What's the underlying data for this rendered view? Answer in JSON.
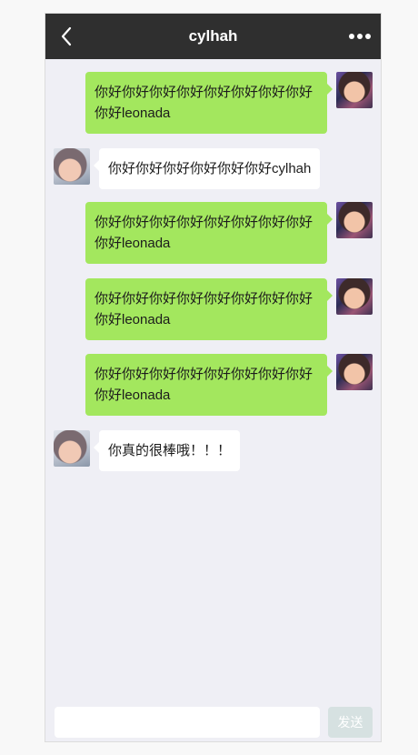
{
  "header": {
    "title": "cylhah",
    "back_icon": "chevron-left-icon",
    "more_icon": "more-dots-icon"
  },
  "messages": [
    {
      "from": "me",
      "text": "你好你好你好你好你好你好你好你好你好leonada"
    },
    {
      "from": "other",
      "text": "你好你好你好你好你好你好cylhah"
    },
    {
      "from": "me",
      "text": "你好你好你好你好你好你好你好你好你好leonada"
    },
    {
      "from": "me",
      "text": "你好你好你好你好你好你好你好你好你好leonada"
    },
    {
      "from": "me",
      "text": "你好你好你好你好你好你好你好你好你好leonada"
    },
    {
      "from": "other",
      "text": "你真的很棒哦！！！"
    }
  ],
  "composer": {
    "input_value": "",
    "send_label": "发送"
  },
  "colors": {
    "header_bg": "#2f2f2f",
    "chat_bg": "#efeff5",
    "my_bubble": "#a3e75e",
    "other_bubble": "#ffffff",
    "send_button_disabled": "#d6e1e1"
  }
}
